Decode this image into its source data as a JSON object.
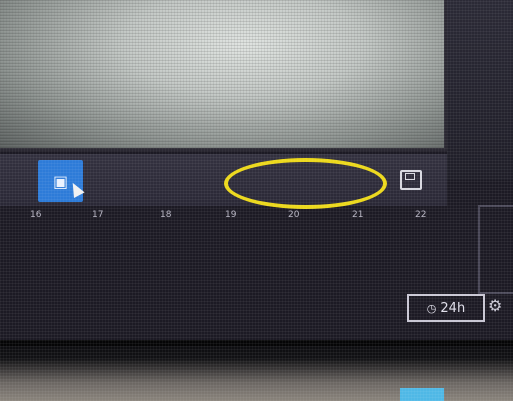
{
  "timeline": {
    "ticks": [
      "16",
      "17",
      "18",
      "19",
      "20",
      "21",
      "22"
    ]
  },
  "duration": {
    "label": "24h"
  },
  "icons": {
    "camera": "camera-icon",
    "save": "save-icon",
    "clock": "clock-icon",
    "settings": "settings-icon"
  },
  "colors": {
    "accent": "#2d7bd8",
    "highlight": "#ecd81a"
  }
}
